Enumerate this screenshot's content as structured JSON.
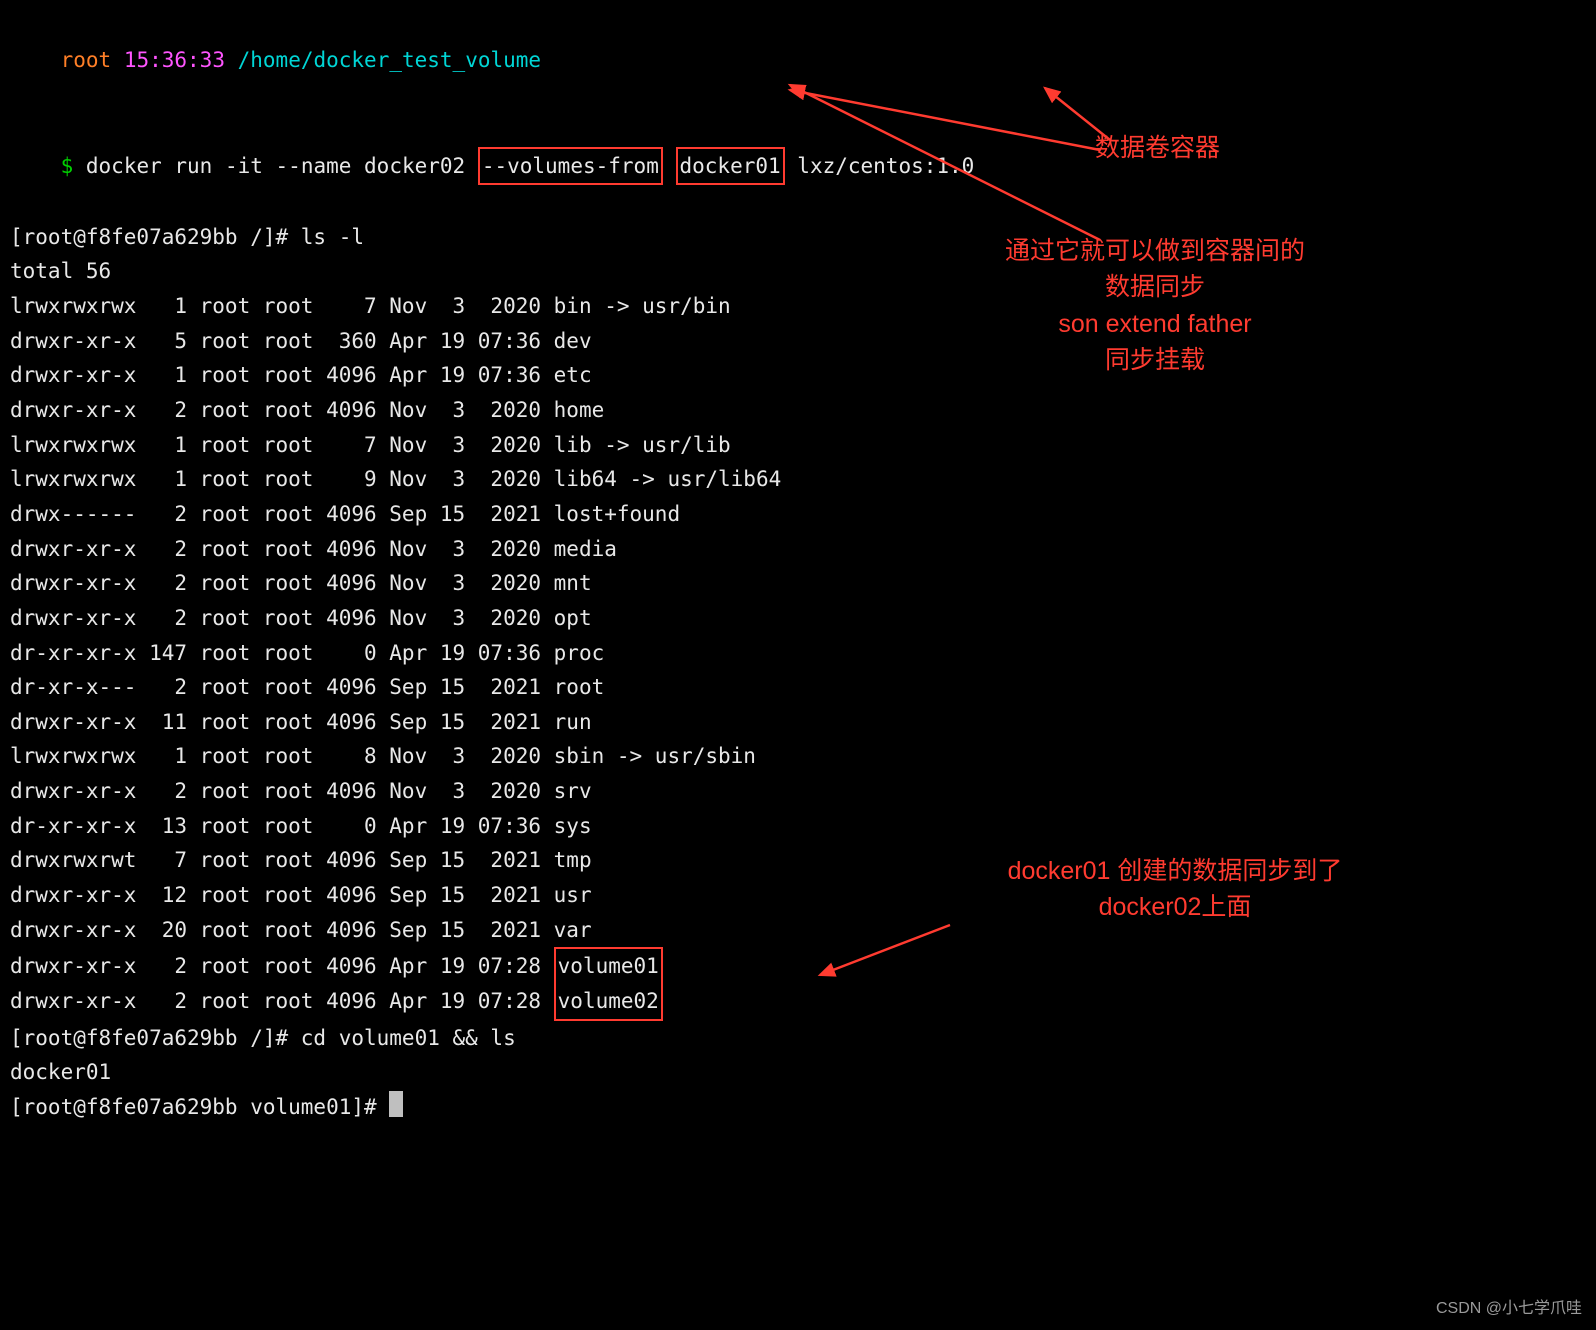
{
  "prompt_header": {
    "user": "root",
    "time": "15:36:33",
    "path": "/home/docker_test_volume"
  },
  "command_line": {
    "prompt": "$",
    "cmd_before": "docker run -it --name docker02 ",
    "boxed1": "--volumes-from",
    "space": " ",
    "boxed2": "docker01",
    "cmd_after": " lxz/centos:1.0"
  },
  "container_prompt1": "[root@f8fe07a629bb /]# ls -l",
  "total_line": "total 56",
  "listing": [
    "lrwxrwxrwx   1 root root    7 Nov  3  2020 bin -> usr/bin",
    "drwxr-xr-x   5 root root  360 Apr 19 07:36 dev",
    "drwxr-xr-x   1 root root 4096 Apr 19 07:36 etc",
    "drwxr-xr-x   2 root root 4096 Nov  3  2020 home",
    "lrwxrwxrwx   1 root root    7 Nov  3  2020 lib -> usr/lib",
    "lrwxrwxrwx   1 root root    9 Nov  3  2020 lib64 -> usr/lib64",
    "drwx------   2 root root 4096 Sep 15  2021 lost+found",
    "drwxr-xr-x   2 root root 4096 Nov  3  2020 media",
    "drwxr-xr-x   2 root root 4096 Nov  3  2020 mnt",
    "drwxr-xr-x   2 root root 4096 Nov  3  2020 opt",
    "dr-xr-xr-x 147 root root    0 Apr 19 07:36 proc",
    "dr-xr-x---   2 root root 4096 Sep 15  2021 root",
    "drwxr-xr-x  11 root root 4096 Sep 15  2021 run",
    "lrwxrwxrwx   1 root root    8 Nov  3  2020 sbin -> usr/sbin",
    "drwxr-xr-x   2 root root 4096 Nov  3  2020 srv",
    "dr-xr-xr-x  13 root root    0 Apr 19 07:36 sys",
    "drwxrwxrwt   7 root root 4096 Sep 15  2021 tmp",
    "drwxr-xr-x  12 root root 4096 Sep 15  2021 usr",
    "drwxr-xr-x  20 root root 4096 Sep 15  2021 var"
  ],
  "volume_rows": {
    "prefix": "drwxr-xr-x   2 root root 4096 Apr 19 07:28 ",
    "v1": "volume01",
    "v2": "volume02"
  },
  "container_prompt2": "[root@f8fe07a629bb /]# cd volume01 && ls",
  "cd_output": "docker01",
  "container_prompt3": "[root@f8fe07a629bb volume01]# ",
  "annotations": {
    "a1": "数据卷容器",
    "a2": "通过它就可以做到容器间的\n数据同步\nson extend father\n同步挂载",
    "a3": "docker01 创建的数据同步到了\ndocker02上面"
  },
  "watermark": "CSDN @小七学爪哇"
}
